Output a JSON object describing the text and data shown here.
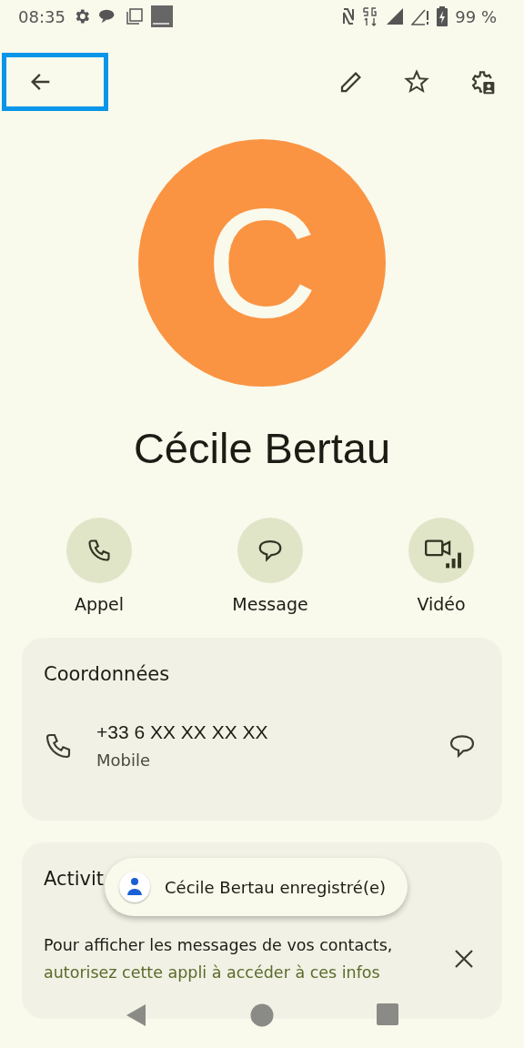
{
  "status_bar": {
    "time": "08:35",
    "battery": "99 %"
  },
  "toolbar": {
    "back_highlighted": true
  },
  "contact": {
    "initial": "C",
    "name": "Cécile Bertau"
  },
  "actions": [
    {
      "kind": "call",
      "label": "Appel"
    },
    {
      "kind": "message",
      "label": "Message"
    },
    {
      "kind": "video",
      "label": "Vidéo"
    }
  ],
  "details": {
    "title": "Coordonnées",
    "phone": "+33 6 XX XX XX XX",
    "phone_type": "Mobile"
  },
  "activity": {
    "title": "Activit",
    "notice": "Pour afficher les messages de vos contacts,",
    "link": "autorisez cette appli à accéder à ces infos"
  },
  "toast": {
    "text": "Cécile Bertau enregistré(e)"
  }
}
